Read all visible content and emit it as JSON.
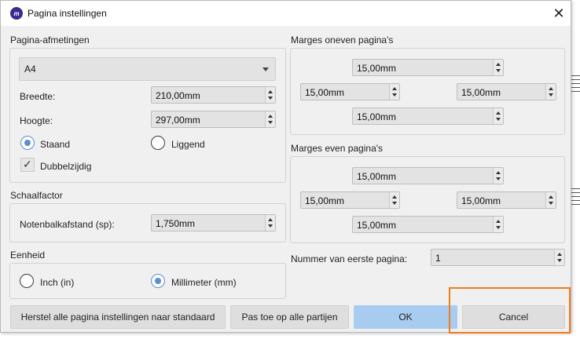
{
  "window": {
    "title": "Pagina instellingen",
    "app_icon_text": "m"
  },
  "page_size": {
    "section_label": "Pagina-afmetingen",
    "paper": "A4",
    "width_label": "Breedte:",
    "width_value": "210,00mm",
    "height_label": "Hoogte:",
    "height_value": "297,00mm",
    "orientation_portrait": "Staand",
    "orientation_landscape": "Liggend",
    "portrait_selected": true,
    "double_sided_label": "Dubbelzijdig",
    "double_sided_checked": true
  },
  "scaling": {
    "section_label": "Schaalfactor",
    "staff_space_label": "Notenbalkafstand (sp):",
    "staff_space_value": "1,750mm"
  },
  "units": {
    "section_label": "Eenheid",
    "inch_label": "Inch (in)",
    "mm_label": "Millimeter (mm)",
    "mm_selected": true
  },
  "margins_odd": {
    "section_label": "Marges oneven pagina's",
    "top": "15,00mm",
    "left": "15,00mm",
    "right": "15,00mm",
    "bottom": "15,00mm"
  },
  "margins_even": {
    "section_label": "Marges even pagina's",
    "top": "15,00mm",
    "left": "15,00mm",
    "right": "15,00mm",
    "bottom": "15,00mm"
  },
  "first_page": {
    "label": "Nummer van eerste pagina:",
    "value": "1"
  },
  "buttons": {
    "reset": "Herstel alle pagina instellingen naar standaard",
    "apply_all": "Pas toe op alle partijen",
    "ok": "OK",
    "cancel": "Cancel"
  },
  "colors": {
    "accent": "#5b8fd1",
    "primary_button": "#a8ccf0",
    "highlight": "#f07c1e",
    "app_icon": "#3b2a8f"
  }
}
